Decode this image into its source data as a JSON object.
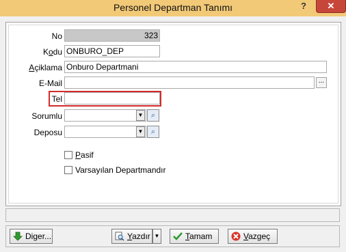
{
  "window": {
    "title": "Personel Departman Tanımı",
    "help": "?",
    "close": "✕"
  },
  "form": {
    "no": {
      "label": "No",
      "value": "323"
    },
    "kodu": {
      "label_pre": "K",
      "label_u": "o",
      "label_post": "du",
      "value": "ONBURO_DEP"
    },
    "aciklama": {
      "label_u": "A",
      "label_post": "çiklama",
      "value": "Onburo Departmani"
    },
    "email": {
      "label": "E-Mail",
      "value": "",
      "button": "..."
    },
    "tel": {
      "label": "Tel",
      "value": ""
    },
    "sorumlu": {
      "label": "Sorumlu",
      "value": ""
    },
    "deposu": {
      "label": "Deposu",
      "value": ""
    },
    "pasif": {
      "label_u": "P",
      "label_post": "asif",
      "checked": false
    },
    "varsayilan": {
      "label": "Varsayılan Departmandır",
      "checked": false
    }
  },
  "buttons": {
    "diger": {
      "pre": "Di",
      "u": "g",
      "post": "er..."
    },
    "yazdir": {
      "u": "Y",
      "post": "azdır"
    },
    "tamam": {
      "u": "T",
      "post": "amam"
    },
    "vazgec": {
      "u": "V",
      "post": "azgeç"
    }
  }
}
